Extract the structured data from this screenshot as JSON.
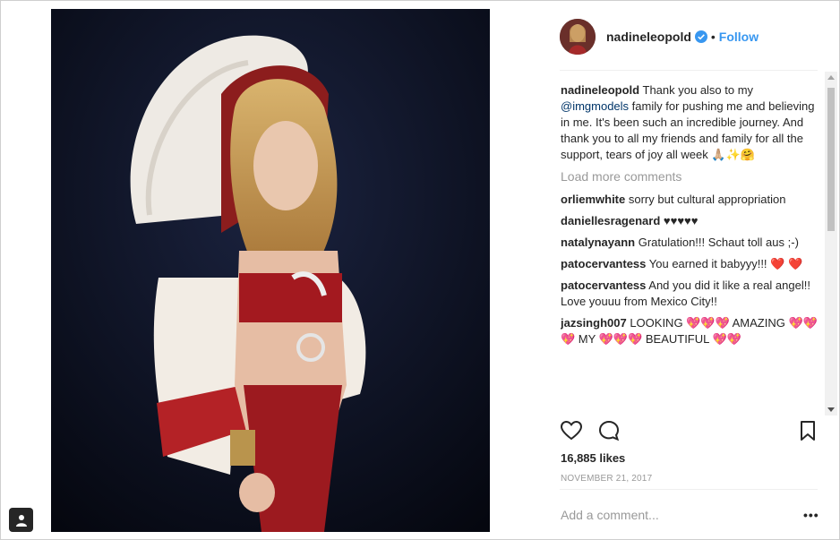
{
  "post": {
    "username": "nadineleopold",
    "follow_label": "Follow",
    "separator": "•",
    "caption": {
      "username": "nadineleopold",
      "text_before": " Thank you also to my ",
      "mention": "@imgmodels",
      "text_after": " family for pushing me and believing in me. It's been such an incredible journey. And thank you to all my friends and family for all the support, tears of joy all week 🙏🏼✨🤗"
    },
    "load_more_label": "Load more comments",
    "comments": [
      {
        "user": "orliemwhite",
        "text": " sorry but cultural appropriation"
      },
      {
        "user": "daniellesragenard",
        "text": " ♥♥♥♥♥"
      },
      {
        "user": "natalynayann",
        "text": " Gratulation!!! Schaut toll aus ;-)"
      },
      {
        "user": "patocervantess",
        "text": " You earned it babyyy!!! ❤️ ❤️"
      },
      {
        "user": "patocervantess",
        "text": " And you did it like a real angel!! Love youuu from Mexico City!!"
      },
      {
        "user": "jazsingh007",
        "text": " LOOKING 💖💖💖 AMAZING 💖💖💖 MY 💖💖💖 BEAUTIFUL 💖💖"
      }
    ],
    "likes": "16,885 likes",
    "date": "NOVEMBER 21, 2017",
    "add_comment_placeholder": "Add a comment...",
    "more_options": "•••"
  },
  "icons": {
    "like": "heart-icon",
    "comment": "comment-icon",
    "save": "bookmark-icon",
    "verified": "verified-badge-icon",
    "tag": "user-tag-icon"
  },
  "colors": {
    "link": "#3897f0",
    "mention": "#003569",
    "muted": "#999999",
    "text": "#262626"
  }
}
